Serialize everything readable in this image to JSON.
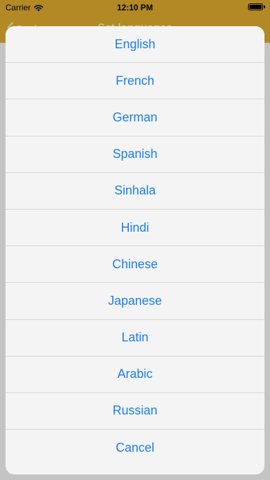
{
  "status_bar": {
    "carrier": "Carrier",
    "time": "12:10 PM",
    "wifi_icon": "wifi-icon",
    "battery_icon": "battery-icon"
  },
  "nav_bar": {
    "back_label": "Back",
    "title": "Set languages",
    "back_icon": "chevron-left-icon"
  },
  "colors": {
    "bar": "#d9a82c",
    "accent": "#1a7ef2",
    "sheet_bg": "#f4f4f4"
  },
  "action_sheet": {
    "options": [
      {
        "label": "English"
      },
      {
        "label": "French"
      },
      {
        "label": "German"
      },
      {
        "label": "Spanish"
      },
      {
        "label": "Sinhala"
      },
      {
        "label": "Hindi"
      },
      {
        "label": "Chinese"
      },
      {
        "label": "Japanese"
      },
      {
        "label": "Latin"
      },
      {
        "label": "Arabic"
      },
      {
        "label": "Russian"
      },
      {
        "label": "Cancel"
      }
    ]
  }
}
